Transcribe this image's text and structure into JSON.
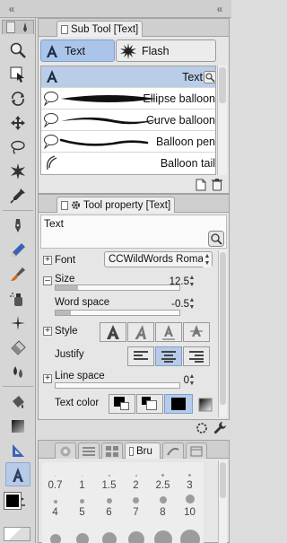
{
  "sub_tool_panel": {
    "tab_title": "Sub Tool [Text]",
    "groups": [
      {
        "label": "Text",
        "selected": true
      },
      {
        "label": "Flash",
        "selected": false
      }
    ],
    "items": [
      {
        "label": "Text",
        "icon": "text-a-icon",
        "selected": true
      },
      {
        "label": "Ellipse balloon",
        "icon": "ellipse-balloon-icon"
      },
      {
        "label": "Curve balloon",
        "icon": "curve-balloon-icon"
      },
      {
        "label": "Balloon pen",
        "icon": "balloon-pen-icon"
      },
      {
        "label": "Balloon tail",
        "icon": "balloon-tail-icon"
      }
    ]
  },
  "tool_property_panel": {
    "tab_title": "Tool property [Text]",
    "tool_name": "Text",
    "font": {
      "label": "Font",
      "value": "CCWildWords Roman"
    },
    "size": {
      "label": "Size",
      "value": "12.5",
      "level": 0.18
    },
    "word_space": {
      "label": "Word space",
      "value": "-0.5",
      "level": 0.12
    },
    "style": {
      "label": "Style"
    },
    "justify": {
      "label": "Justify",
      "selected_index": 1
    },
    "line_space": {
      "label": "Line space",
      "value": "0",
      "level": 0.0
    },
    "text_color": {
      "label": "Text color"
    }
  },
  "brush_size_panel": {
    "tab_label": "Bru",
    "rows": [
      [
        "0.7",
        "1",
        "1.5",
        "2",
        "2.5",
        "3"
      ],
      [
        "4",
        "5",
        "6",
        "7",
        "8",
        "10"
      ]
    ]
  },
  "colors": {
    "selection": "#b7cbe6",
    "main_color": "#000000",
    "sub_color": "#ffffff"
  }
}
